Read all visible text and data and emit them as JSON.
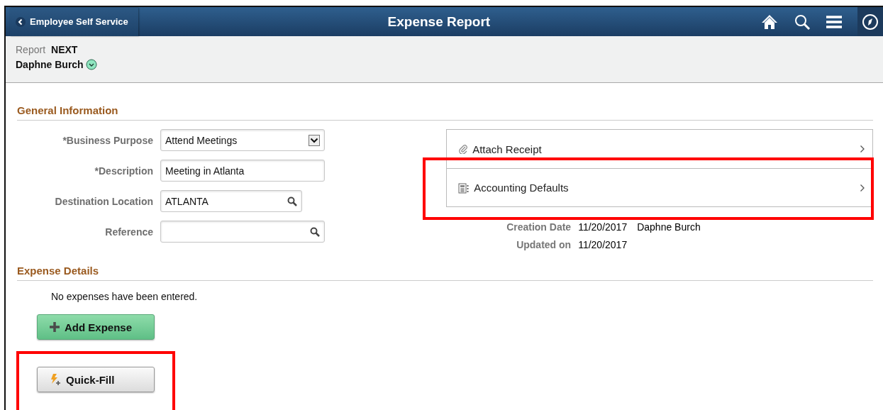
{
  "header": {
    "back_label": "Employee Self Service",
    "title": "Expense Report"
  },
  "report": {
    "label": "Report",
    "value": "NEXT",
    "employee": "Daphne Burch"
  },
  "general": {
    "heading": "General Information",
    "fields": [
      {
        "kind": "select",
        "label": "*Business Purpose",
        "value": "Attend Meetings"
      },
      {
        "kind": "text",
        "label": "*Description",
        "value": "Meeting in Atlanta"
      },
      {
        "kind": "lookup",
        "label": "Destination Location",
        "value": "ATLANTA"
      },
      {
        "kind": "lookup",
        "label": "Reference"
      }
    ],
    "links": [
      {
        "kind": "attach",
        "label": "Attach Receipt"
      },
      {
        "kind": "accounting",
        "label": "Accounting Defaults",
        "highlighted": true
      }
    ],
    "info": [
      {
        "label": "Creation Date",
        "value": "11/20/2017",
        "extra": "Daphne Burch"
      },
      {
        "label": "Updated on",
        "value": "11/20/2017"
      }
    ]
  },
  "expenses": {
    "heading": "Expense Details",
    "message": "No expenses have been entered.",
    "buttons": [
      {
        "kind": "add",
        "label": "Add Expense"
      },
      {
        "kind": "quickfill",
        "label": "Quick-Fill",
        "highlighted": true
      }
    ]
  }
}
